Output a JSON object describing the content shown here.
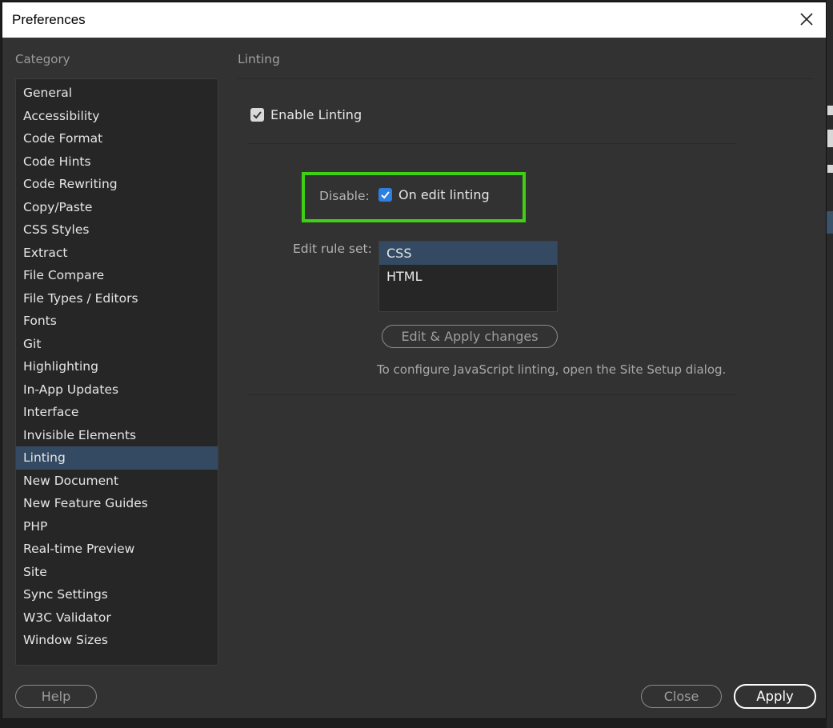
{
  "window": {
    "title": "Preferences"
  },
  "category": {
    "header": "Category",
    "items": [
      "General",
      "Accessibility",
      "Code Format",
      "Code Hints",
      "Code Rewriting",
      "Copy/Paste",
      "CSS Styles",
      "Extract",
      "File Compare",
      "File Types / Editors",
      "Fonts",
      "Git",
      "Highlighting",
      "In-App Updates",
      "Interface",
      "Invisible Elements",
      "Linting",
      "New Document",
      "New Feature Guides",
      "PHP",
      "Real-time Preview",
      "Site",
      "Sync Settings",
      "W3C Validator",
      "Window Sizes"
    ],
    "selected": "Linting"
  },
  "linting": {
    "section_title": "Linting",
    "enable_label": "Enable Linting",
    "enable_checked": true,
    "disable_label": "Disable:",
    "on_edit_label": "On edit linting",
    "on_edit_checked": true,
    "rule_set_label": "Edit rule set:",
    "rule_sets": [
      "CSS",
      "HTML"
    ],
    "rule_set_selected": "CSS",
    "edit_apply_label": "Edit  & Apply changes",
    "js_note": "To configure JavaScript linting, open the Site Setup dialog."
  },
  "footer": {
    "help_label": "Help",
    "close_label": "Close",
    "apply_label": "Apply"
  },
  "colors": {
    "highlight": "#3fd014",
    "selection": "#344a62",
    "checkbox_blue": "#2d7fe0"
  },
  "icons": {
    "close": "close-icon",
    "checkmark": "checkmark-icon"
  }
}
